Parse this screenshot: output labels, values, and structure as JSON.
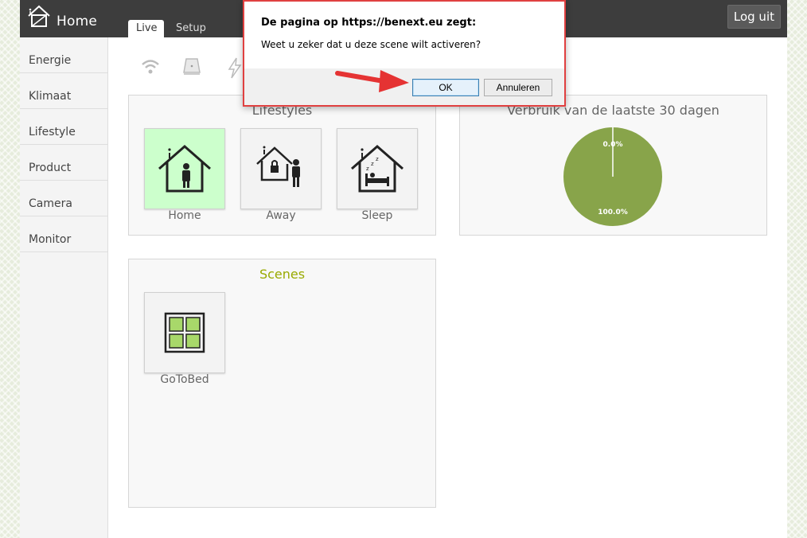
{
  "header": {
    "brand": "Home",
    "logout_label": "Log uit"
  },
  "tabs": [
    {
      "label": "Live"
    },
    {
      "label": "Setup"
    }
  ],
  "sidebar": {
    "items": [
      {
        "label": "Energie"
      },
      {
        "label": "Klimaat"
      },
      {
        "label": "Lifestyle"
      },
      {
        "label": "Product"
      },
      {
        "label": "Camera"
      },
      {
        "label": "Monitor"
      }
    ]
  },
  "status_icons": [
    "wifi-icon",
    "gateway-icon",
    "lightning-icon"
  ],
  "lifestyles": {
    "title": "Lifestyles",
    "items": [
      {
        "label": "Home",
        "icon": "home-person-icon",
        "active": true
      },
      {
        "label": "Away",
        "icon": "away-lock-icon",
        "active": false
      },
      {
        "label": "Sleep",
        "icon": "sleep-bed-icon",
        "active": false
      }
    ]
  },
  "usage": {
    "title": "Verbruik van de laatste 30 dagen",
    "color": "#88a44a",
    "chart_data": {
      "type": "pie",
      "labels": [
        "0.0%",
        "100.0%"
      ],
      "values": [
        0.0,
        100.0
      ]
    }
  },
  "scenes": {
    "title": "Scenes",
    "title_color": "#99aa00",
    "items": [
      {
        "label": "GoToBed",
        "icon": "scene-grid-icon"
      }
    ]
  },
  "dialog": {
    "title": "De pagina op https://benext.eu zegt:",
    "message": "Weet u zeker dat u deze scene wilt activeren?",
    "ok_label": "OK",
    "cancel_label": "Annuleren"
  }
}
